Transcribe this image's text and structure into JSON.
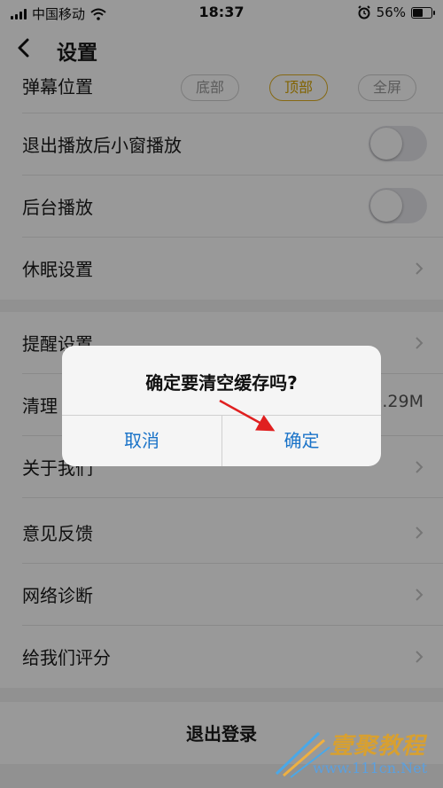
{
  "status_bar": {
    "carrier": "中国移动",
    "time": "18:37",
    "battery": "56%",
    "battery_level": 0.56
  },
  "header": {
    "title": "设置"
  },
  "settings": {
    "danmaku_position": {
      "label": "弹幕位置",
      "options": [
        "底部",
        "顶部",
        "全屏"
      ],
      "selected": "顶部"
    },
    "mini_window": {
      "label": "退出播放后小窗播放",
      "enabled": false
    },
    "background_play": {
      "label": "后台播放",
      "enabled": false
    },
    "sleep": {
      "label": "休眠设置"
    },
    "reminder": {
      "label": "提醒设置"
    },
    "clear_cache": {
      "label": "清理缓存",
      "visible_label": "清理",
      "value": "0.29M"
    },
    "about": {
      "label": "关于我们"
    },
    "feedback": {
      "label": "意见反馈"
    },
    "network": {
      "label": "网络诊断"
    },
    "rate": {
      "label": "给我们评分"
    },
    "logout": {
      "label": "退出登录"
    }
  },
  "dialog": {
    "title": "确定要清空缓存吗?",
    "cancel_label": "取消",
    "confirm_label": "确定"
  },
  "watermark": {
    "title": "壹聚教程",
    "url": "www.111cn.Net"
  },
  "colors": {
    "accent_selected": "#d8a500",
    "dialog_button": "#1a73c8",
    "arrow": "#e02020"
  }
}
